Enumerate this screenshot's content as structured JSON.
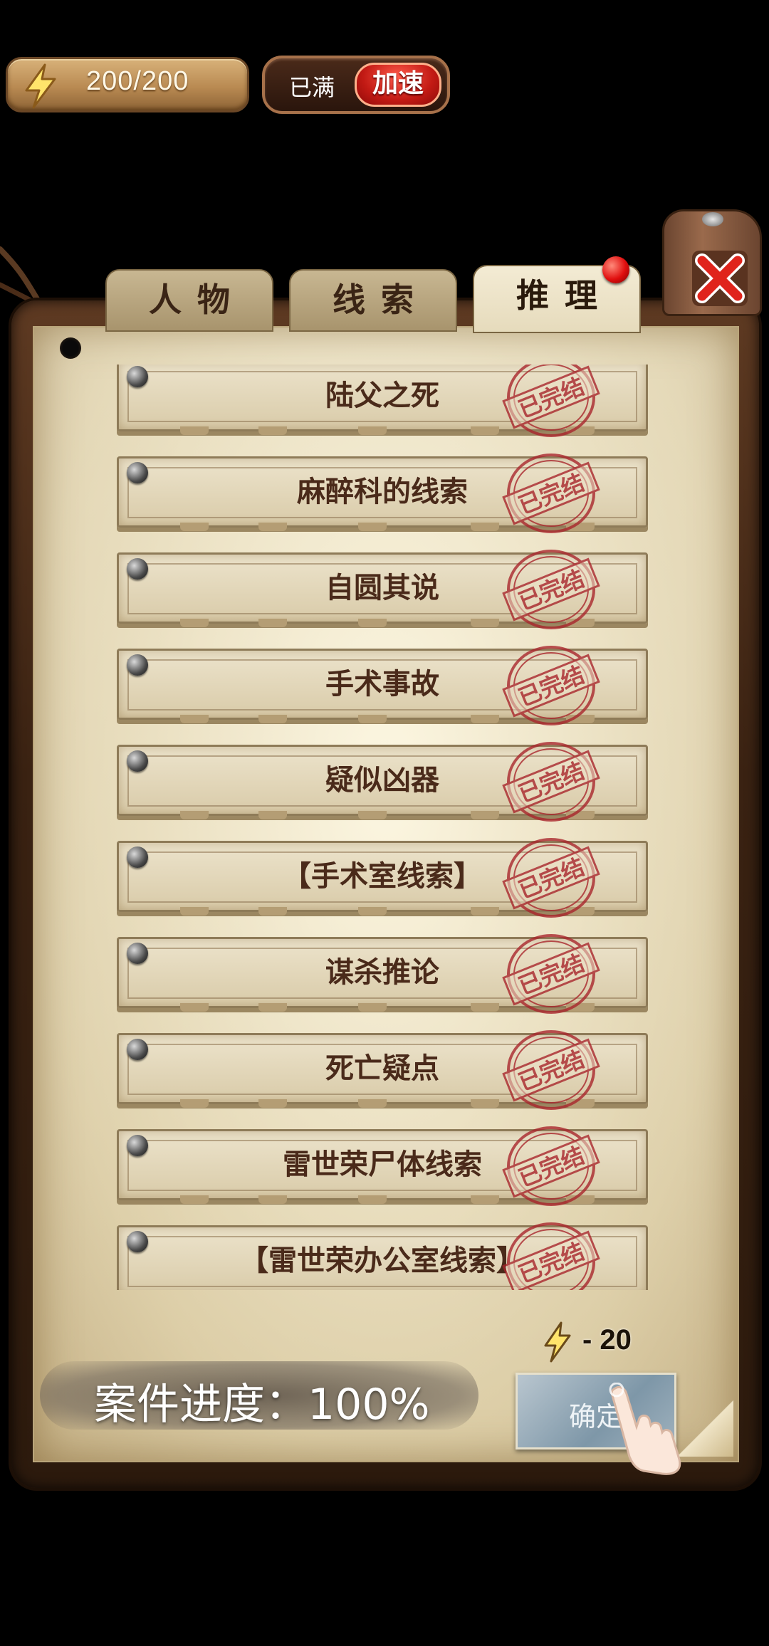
{
  "topbar": {
    "energy": "200/200",
    "refill_status": "已满",
    "speedup_label": "加速"
  },
  "tabs": [
    {
      "label": "人物",
      "active": false
    },
    {
      "label": "线索",
      "active": false
    },
    {
      "label": "推理",
      "active": true,
      "badge": true
    }
  ],
  "cases": [
    {
      "title": "陆父之死",
      "stamp": "已完结"
    },
    {
      "title": "麻醉科的线索",
      "stamp": "已完结"
    },
    {
      "title": "自圆其说",
      "stamp": "已完结"
    },
    {
      "title": "手术事故",
      "stamp": "已完结"
    },
    {
      "title": "疑似凶器",
      "stamp": "已完结"
    },
    {
      "title": "【手术室线索】",
      "stamp": "已完结"
    },
    {
      "title": "谋杀推论",
      "stamp": "已完结"
    },
    {
      "title": "死亡疑点",
      "stamp": "已完结"
    },
    {
      "title": "雷世荣尸体线索",
      "stamp": "已完结"
    },
    {
      "title": "【雷世荣办公室线索】",
      "stamp": "已完结"
    }
  ],
  "footer": {
    "progress_text": "案件进度：100%",
    "cost_text": "- 20",
    "confirm_label": "确定"
  },
  "colors": {
    "stamp_red": "#a8232a",
    "title_brown": "#4a2a1a",
    "speedup_red": "#c21a14"
  },
  "icons": [
    "lightning-icon",
    "close-icon",
    "pin-icon",
    "completed-stamp",
    "tap-hand-icon"
  ]
}
